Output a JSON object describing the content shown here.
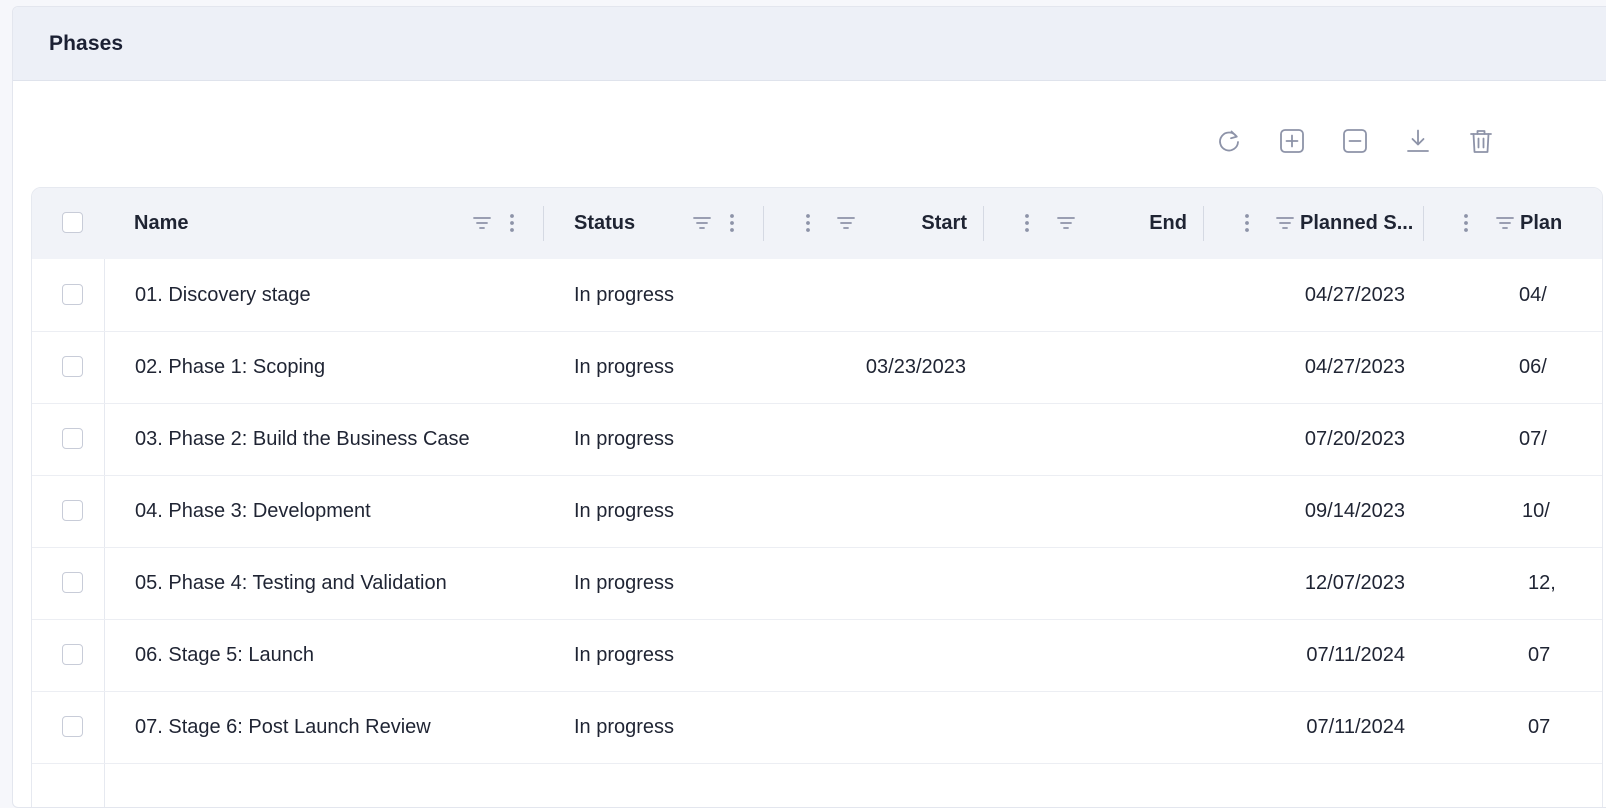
{
  "panel": {
    "title": "Phases"
  },
  "toolbar": {
    "buttons": [
      {
        "icon": "refresh-icon"
      },
      {
        "icon": "add-square-icon"
      },
      {
        "icon": "remove-square-icon"
      },
      {
        "icon": "download-icon"
      },
      {
        "icon": "trash-icon"
      }
    ]
  },
  "table": {
    "columns": {
      "name": "Name",
      "status": "Status",
      "start": "Start",
      "end": "End",
      "planned_start": "Planned S...",
      "planned_end": "Plan"
    },
    "rows": [
      {
        "name": "01. Discovery stage",
        "status": "In progress",
        "start": "",
        "end": "",
        "planned_start": "04/27/2023",
        "planned_end": "04/"
      },
      {
        "name": "02. Phase 1: Scoping",
        "status": "In progress",
        "start": "03/23/2023",
        "end": "",
        "planned_start": "04/27/2023",
        "planned_end": "06/"
      },
      {
        "name": "03. Phase 2: Build the Business Case",
        "status": "In progress",
        "start": "",
        "end": "",
        "planned_start": "07/20/2023",
        "planned_end": "07/"
      },
      {
        "name": "04. Phase 3: Development",
        "status": "In progress",
        "start": "",
        "end": "",
        "planned_start": "09/14/2023",
        "planned_end": "10/"
      },
      {
        "name": "05. Phase 4: Testing and Validation",
        "status": "In progress",
        "start": "",
        "end": "",
        "planned_start": "12/07/2023",
        "planned_end": "12,"
      },
      {
        "name": "06. Stage 5: Launch",
        "status": "In progress",
        "start": "",
        "end": "",
        "planned_start": "07/11/2024",
        "planned_end": "07"
      },
      {
        "name": "07. Stage 6: Post Launch Review",
        "status": "In progress",
        "start": "",
        "end": "",
        "planned_start": "07/11/2024",
        "planned_end": "07"
      }
    ]
  }
}
